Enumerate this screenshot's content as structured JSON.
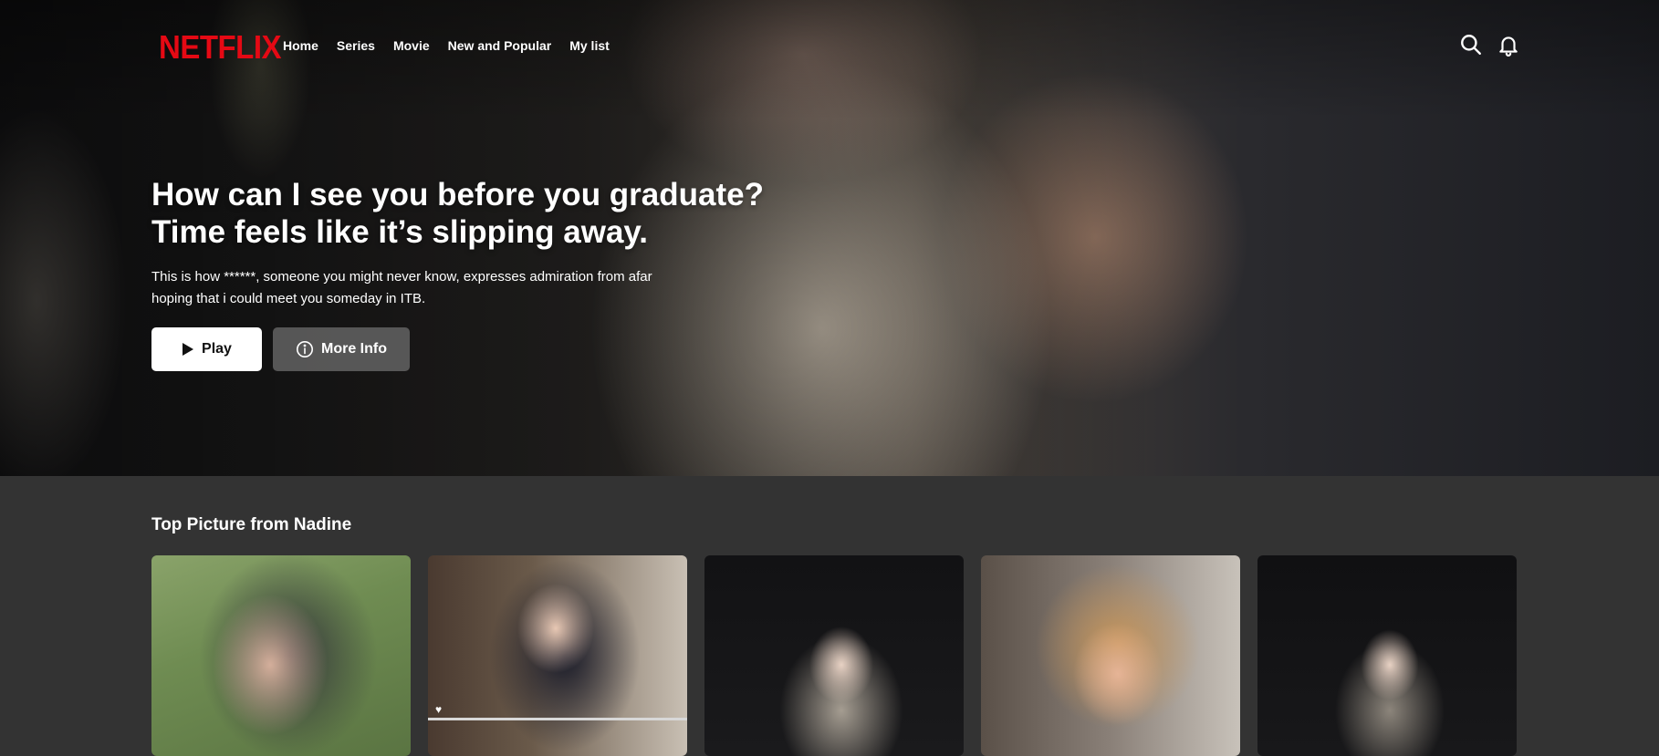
{
  "brand": {
    "logo_text": "NETFLIX",
    "logo_color": "#e50914"
  },
  "nav": {
    "items": [
      {
        "label": "Home"
      },
      {
        "label": "Series"
      },
      {
        "label": "Movie"
      },
      {
        "label": "New and Popular"
      },
      {
        "label": "My list"
      }
    ]
  },
  "header_icons": {
    "search": "search-icon",
    "notifications": "bell-icon"
  },
  "hero": {
    "title_line1": "How can I see you before you graduate?",
    "title_line2": "Time feels like it’s slipping away.",
    "desc_line1": "This is how ******, someone you might never know, expresses admiration from afar",
    "desc_line2": "hoping that i could meet you someday in ITB.",
    "play_label": "Play",
    "info_label": "More Info"
  },
  "row": {
    "title": "Top Picture from Nadine",
    "card_count": 5
  },
  "colors": {
    "background": "#333333",
    "play_bg": "#ffffff",
    "info_bg": "#6d6d6e"
  }
}
